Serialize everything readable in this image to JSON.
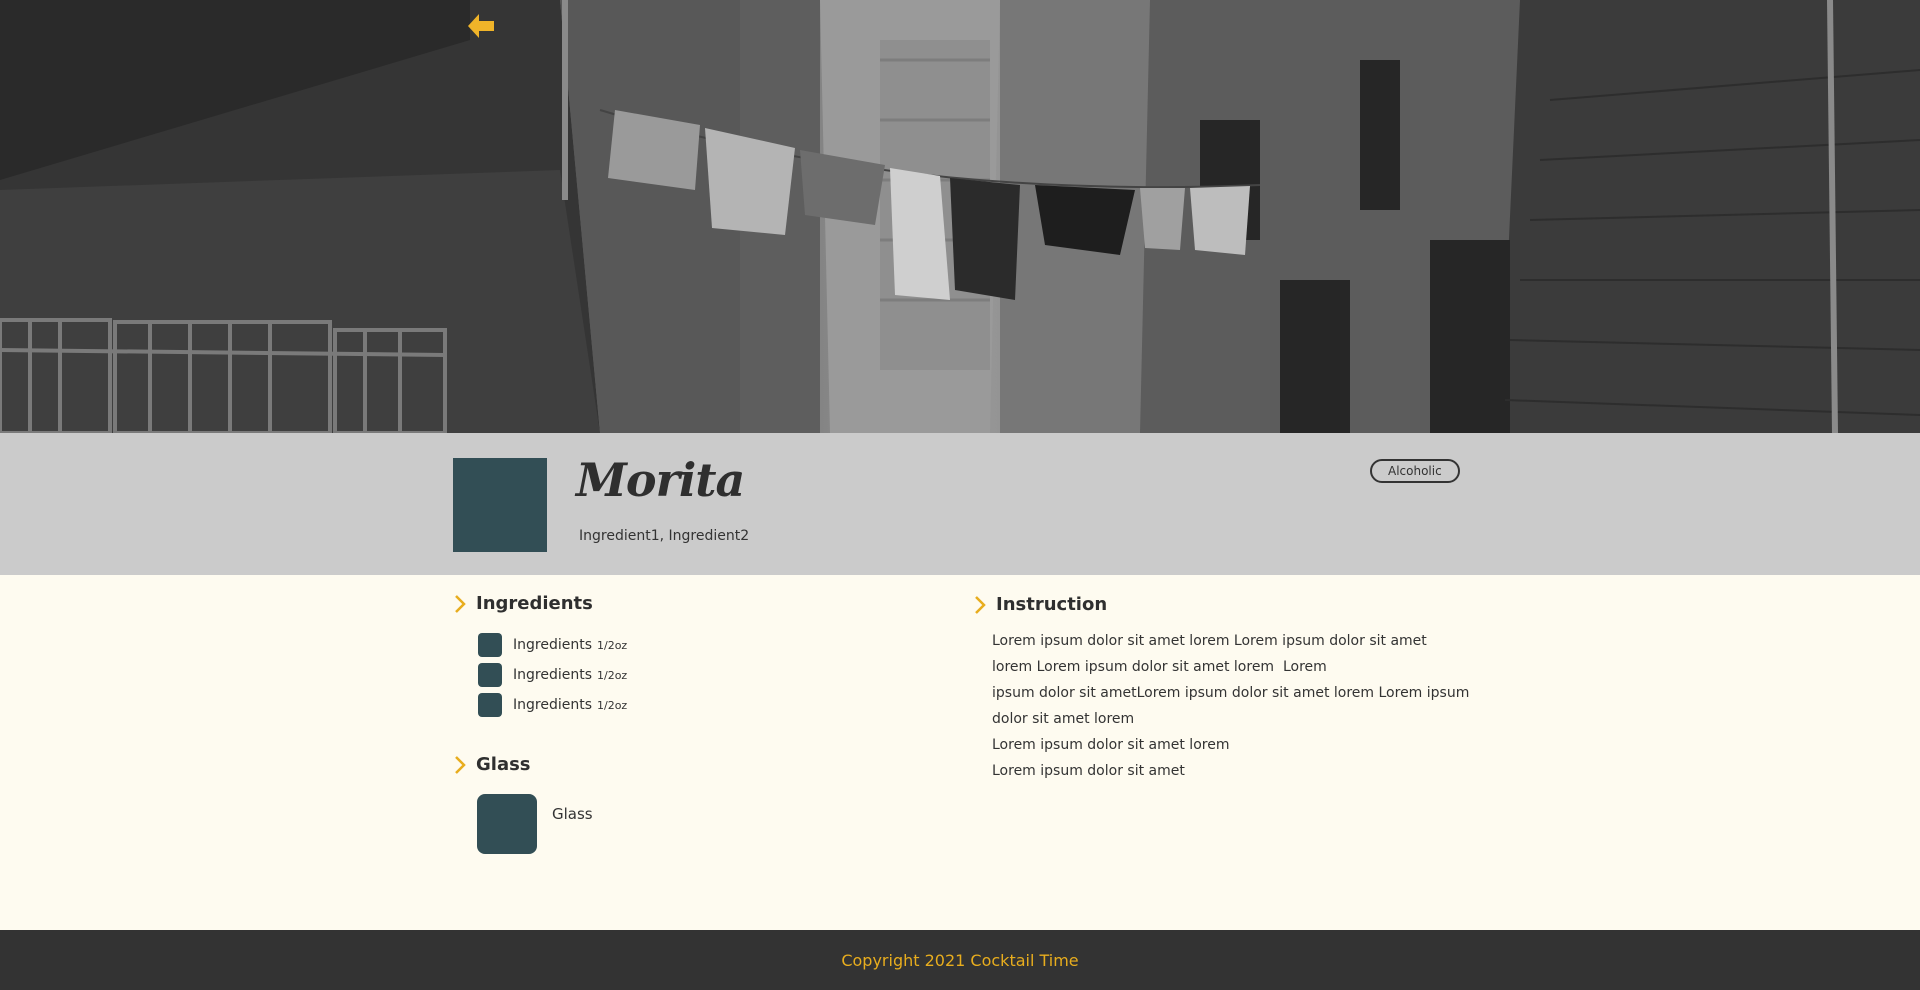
{
  "hero": {
    "back_icon": "arrow-left-icon",
    "accent_color": "#f0b429"
  },
  "drink": {
    "name": "Morita",
    "ingredients_summary": "Ingredient1, Ingredient2",
    "category": "Alcoholic",
    "swatch_color": "#324e55"
  },
  "ingredients": {
    "heading": "Ingredients",
    "items": [
      {
        "name": "Ingredients",
        "amount": "1/2oz"
      },
      {
        "name": "Ingredients",
        "amount": "1/2oz"
      },
      {
        "name": "Ingredients",
        "amount": "1/2oz"
      }
    ]
  },
  "glass": {
    "heading": "Glass",
    "name": "Glass"
  },
  "instruction": {
    "heading": "Instruction",
    "lines": [
      "Lorem ipsum dolor sit amet lorem Lorem ipsum dolor sit amet",
      "lorem Lorem ipsum dolor sit amet lorem  Lorem",
      "ipsum dolor sit ametLorem ipsum dolor sit amet lorem Lorem ipsum",
      "dolor sit amet lorem",
      "Lorem ipsum dolor sit amet lorem",
      "Lorem ipsum dolor sit amet"
    ]
  },
  "footer": {
    "text": "Copyright 2021 Cocktail Time",
    "text_color": "#e8ad1e"
  }
}
